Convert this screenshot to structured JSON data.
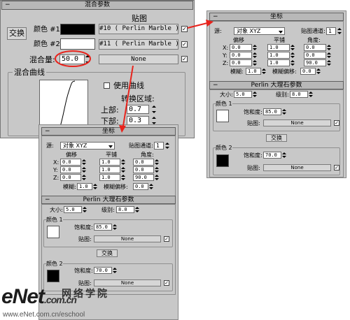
{
  "main": {
    "title": "混合参数",
    "swap_label": "交换",
    "color1_label": "颜色 #1",
    "color2_label": "颜色 #2",
    "map_header": "贴图",
    "map1_label": "#10 ( Perlin Marble )",
    "map2_label": "#11 ( Perlin Marble )",
    "mix_amount_label": "混合量:",
    "mix_amount_value": "50.0",
    "mix_map_label": "None",
    "mix_curve_label": "混合曲线",
    "use_curve_label": "使用曲线",
    "transition_label": "转换区域:",
    "upper_label": "上部:",
    "upper_value": "0.7",
    "lower_label": "下部:",
    "lower_value": "0.3",
    "color1": "#000000",
    "color2": "#ffffff"
  },
  "coords": {
    "title": "坐标",
    "source_label": "源:",
    "source_value": "对象 XYZ",
    "map_channel_label": "贴图通道:",
    "map_channel_value": "1",
    "offset_label": "偏移",
    "tiling_label": "平铺",
    "angle_label": "角度:",
    "rows": [
      {
        "axis": "X:",
        "offset": "0.0",
        "tiling": "1.0",
        "angle": "0.0"
      },
      {
        "axis": "Y:",
        "offset": "0.0",
        "tiling": "1.0",
        "angle": "0.0"
      },
      {
        "axis": "Z:",
        "offset": "0.0",
        "tiling": "1.0",
        "angle": "90.0"
      }
    ],
    "blur_label": "模糊:",
    "blur_value": "1.0",
    "blur_offset_label": "模糊偏移:",
    "blur_offset_value": "0.0"
  },
  "perlin": {
    "title": "Perlin 大理石参数",
    "size_label": "大小:",
    "size_value": "5.0",
    "levels_label": "级别:",
    "levels_value": "8.0",
    "color1_label": "颜色 1",
    "saturation_label": "饱和度:",
    "saturation1": "85.0",
    "map_label": "贴图:",
    "map_none": "None",
    "swap_label": "交换",
    "color2_label": "颜色 2",
    "saturation2": "70.0",
    "swatch1": "#ffffff",
    "swatch2": "#000000"
  },
  "watermark": {
    "brand": "eNet",
    "domain": ".com.cn",
    "chinese": "网络学院",
    "url": "www.eNet.com.cn/eschool"
  },
  "colors": {
    "arrow": "#e8231c",
    "annotation_ellipse": "#e8231c"
  }
}
